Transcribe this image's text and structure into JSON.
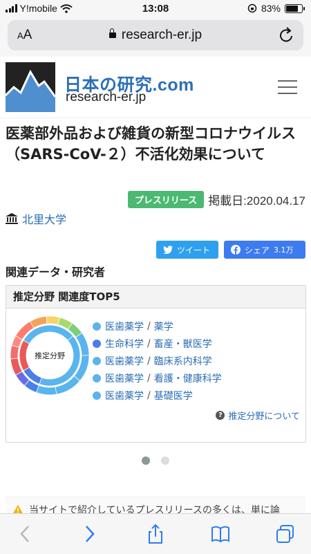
{
  "status": {
    "carrier": "Y!mobile",
    "time": "13:08",
    "battery": "83%",
    "battery_level": 0.83
  },
  "browser": {
    "text_size": "AA",
    "url": "research-er.jp"
  },
  "site": {
    "brand": "日本の研究.com",
    "subtitle": "research-er.jp"
  },
  "article": {
    "title": "医薬部外品および雑貨の新型コロナウイルス （SARS-CoV-２）不活化効果について",
    "badge": "プレスリリース",
    "date": "掲載日:2020.04.17",
    "institution": "北里大学"
  },
  "share": {
    "tweet": "ツイート",
    "share": "シェア",
    "share_count": "3.1万"
  },
  "related": {
    "heading": "関連データ・研究者",
    "card_title": "推定分野 関連度TOP5",
    "donut_label": "推定分野",
    "fields": [
      {
        "main": "医歯薬学",
        "sub": "薬学",
        "color": "#5ab4ee"
      },
      {
        "main": "生命科学",
        "sub": "畜産・獣医学",
        "color": "#4a7fe6"
      },
      {
        "main": "医歯薬学",
        "sub": "臨床系内科学",
        "color": "#5ab4ee"
      },
      {
        "main": "医歯薬学",
        "sub": "看護・健康科学",
        "color": "#5ab4ee"
      },
      {
        "main": "医歯薬学",
        "sub": "基礎医学",
        "color": "#5ab4ee"
      }
    ],
    "about_link": "推定分野について"
  },
  "notice": "当サイトで紹介しているプレスリリースの多くは、単に論"
}
